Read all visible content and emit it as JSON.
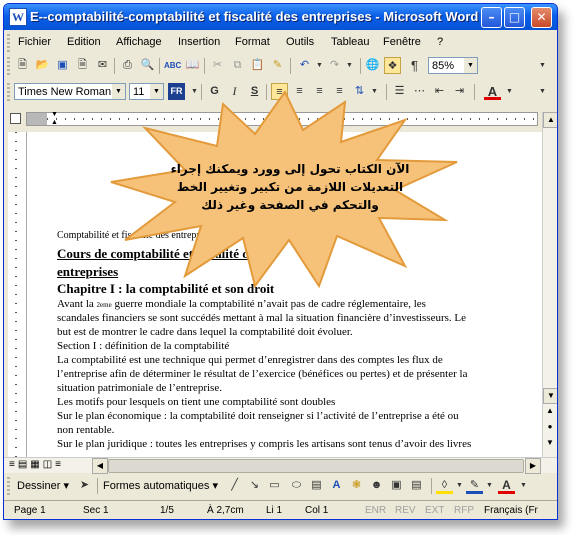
{
  "window": {
    "title": "E--comptabilité-comptabilité et fiscalité des entreprises - Microsoft Word"
  },
  "menu": [
    {
      "label": "Fichier"
    },
    {
      "label": "Edition"
    },
    {
      "label": "Affichage"
    },
    {
      "label": "Insertion"
    },
    {
      "label": "Format"
    },
    {
      "label": "Outils"
    },
    {
      "label": "Tableau"
    },
    {
      "label": "Fenêtre"
    },
    {
      "label": "?"
    }
  ],
  "standard_toolbar": {
    "zoom": "85%"
  },
  "format_toolbar": {
    "font": "Times New Roman",
    "size": "11",
    "lang_badge": "FR",
    "bold": "G",
    "italic": "I",
    "underline": "S",
    "font_color": "A"
  },
  "callout": {
    "text": "الآن الكتاب تحول إلى وورد ويمكنك إجراء التعديلات اللازمة من تكبير وتغيير الخط والتحكم في الصفحة وغير ذلك",
    "fill": "#f6c27a"
  },
  "document": {
    "header": "Comptabilité et fiscalité des entreprises 1",
    "title_line1": "Cours de comptabilité et fiscalité des",
    "title_line2": "entreprises",
    "chapter": "Chapitre I : la comptabilité et son droit",
    "p1_a": "Avant la ",
    "p1_sup": "2eme",
    "p1_b": " guerre mondiale la comptabilité n’avait pas de cadre réglementaire, les",
    "p1_l2": "scandales financiers se sont succédés mettant à mal la situation financière d’investisseurs. Le",
    "p1_l3": "but est de montrer le cadre dans lequel la comptabilité doit évoluer.",
    "section1": "Section I : définition de la comptabilité",
    "p2_l1": "La comptabilité est une technique qui permet d’enregistrer dans des comptes les flux de",
    "p2_l2": "l’entreprise afin de déterminer le résultat de l’exercice (bénéfices ou pertes) et de présenter la",
    "p2_l3": "situation patrimoniale de l’entreprise.",
    "p3": "Les motifs pour lesquels on tient une comptabilité sont doubles",
    "p4_l1": "Sur le plan économique : la comptabilité doit renseigner si l’activité de l’entreprise a été ou",
    "p4_l2": "non rentable.",
    "p5_l1": "Sur le plan juridique : toutes les entreprises y compris les artisans sont tenus d’avoir des livres"
  },
  "drawing_toolbar": {
    "draw_label": "Dessiner",
    "autoshapes_label": "Formes automatiques"
  },
  "status": {
    "page": "Page 1",
    "section": "Sec 1",
    "pages": "1/5",
    "position": "À 2,7cm",
    "line": "Li 1",
    "col": "Col 1",
    "rec": "ENR",
    "rev": "REV",
    "ext": "EXT",
    "ovr": "RFP",
    "language": "Français (Fr"
  }
}
